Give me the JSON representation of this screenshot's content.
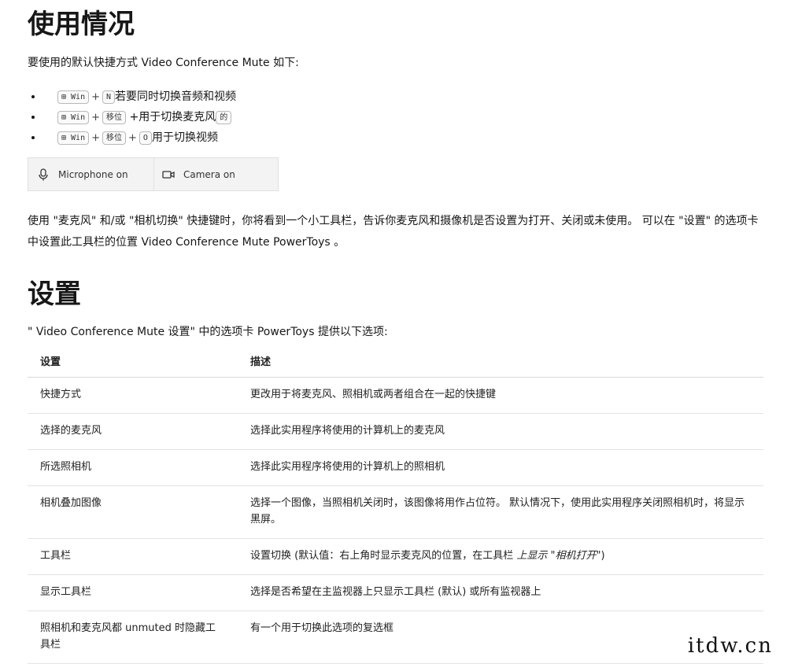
{
  "usage": {
    "heading": "使用情况",
    "intro": "要使用的默认快捷方式 Video Conference Mute 如下:",
    "shortcuts": [
      {
        "keys": [
          "⊞ Win",
          "N"
        ],
        "text": "若要同时切换音频和视频"
      },
      {
        "keys": [
          "⊞ Win",
          "移位"
        ],
        "text": "+用于切换麦克风",
        "trailing_key": "的"
      },
      {
        "keys": [
          "⊞ Win",
          "移位",
          "O"
        ],
        "text": "用于切换视频"
      }
    ],
    "toolbar": {
      "mic_label": "Microphone on",
      "mic_icon": "microphone-icon",
      "cam_label": "Camera on",
      "cam_icon": "camera-icon"
    },
    "description": "使用 \"麦克风\" 和/或 \"相机切换\" 快捷键时，你将看到一个小工具栏，告诉你麦克风和摄像机是否设置为打开、关闭或未使用。 可以在 \"设置\" 的选项卡中设置此工具栏的位置 Video Conference Mute PowerToys 。"
  },
  "settings": {
    "heading": "设置",
    "intro": "\" Video Conference Mute 设置\" 中的选项卡 PowerToys 提供以下选项:",
    "columns": [
      "设置",
      "描述"
    ],
    "rows": [
      {
        "name": "快捷方式",
        "desc": "更改用于将麦克风、照相机或两者组合在一起的快捷键"
      },
      {
        "name": "选择的麦克风",
        "desc": "选择此实用程序将使用的计算机上的麦克风"
      },
      {
        "name": "所选照相机",
        "desc": "选择此实用程序将使用的计算机上的照相机"
      },
      {
        "name": "相机叠加图像",
        "desc": "选择一个图像，当照相机关闭时，该图像将用作占位符。 默认情况下，使用此实用程序关闭照相机时，将显示黑屏。"
      },
      {
        "name": "工具栏",
        "desc": "设置切换 (默认值：右上角时显示麦克风的位置，在工具栏 ",
        "desc_em": "上显示 \"相机打开\"",
        "desc_tail": ")"
      },
      {
        "name": "显示工具栏",
        "desc": "选择是否希望在主监视器上只显示工具栏 (默认) 或所有监视器上"
      },
      {
        "name": "照相机和麦克风都 unmuted 时隐藏工具栏",
        "desc": "有一个用于切换此选项的复选框"
      }
    ]
  },
  "watermark": "itdw.cn"
}
